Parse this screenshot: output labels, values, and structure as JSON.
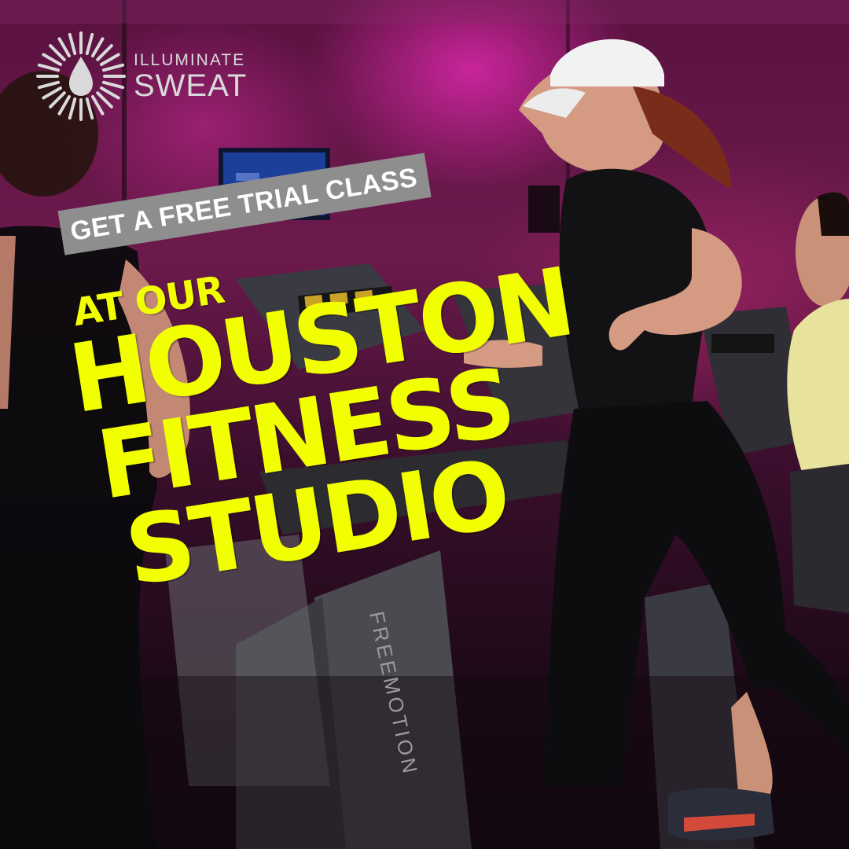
{
  "brand": {
    "line1": "ILLUMINATE",
    "line2": "SWEAT"
  },
  "banner": {
    "text": "GET A FREE TRIAL CLASS"
  },
  "headline": {
    "line1": "AT OUR",
    "line2": "HOUSTON",
    "line3": "FITNESS",
    "line4": "STUDIO"
  },
  "equipment_text": {
    "treadmill_brand": "FREEMOTION"
  },
  "colors": {
    "headline": "#f2ff00",
    "banner_bg": "#8e8e8e",
    "banner_text": "#ffffff",
    "logo_text": "#d9d9d9",
    "ambient_light": "#d62aa6"
  },
  "icons": {
    "logo": "sunburst-droplet-logo"
  }
}
